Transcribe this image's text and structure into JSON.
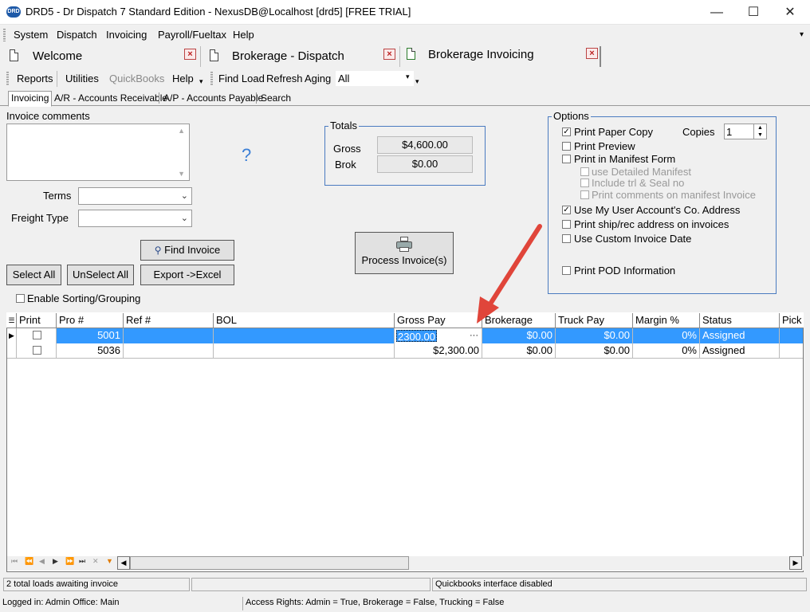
{
  "window": {
    "title": "DRD5 - Dr Dispatch 7 Standard Edition - NexusDB@Localhost [drd5] [FREE TRIAL]",
    "logo_text": "DRD",
    "minimize": "—",
    "maximize": "☐",
    "close": "✕"
  },
  "menu": [
    "System",
    "Dispatch",
    "Invoicing",
    "Payroll/Fueltax",
    "Help"
  ],
  "doc_tabs": [
    {
      "label": "Welcome"
    },
    {
      "label": "Brokerage - Dispatch"
    },
    {
      "label": "Brokerage Invoicing"
    }
  ],
  "toolbar": {
    "reports": "Reports",
    "utilities": "Utilities",
    "quickbooks": "QuickBooks",
    "help": "Help",
    "find_load": "Find Load",
    "refresh": "Refresh",
    "aging": "Aging",
    "aging_value": "All"
  },
  "subtabs": [
    "Invoicing",
    "A/R - Accounts Receivable",
    "A/P - Accounts Payable",
    "Search"
  ],
  "form": {
    "invoice_comments_label": "Invoice comments",
    "terms_label": "Terms",
    "freight_type_label": "Freight Type",
    "help_mark": "?",
    "find_invoice": "Find Invoice",
    "select_all": "Select All",
    "unselect_all": "UnSelect All",
    "export_excel": "Export ->Excel",
    "enable_sorting": "Enable Sorting/Grouping",
    "process_invoices": "Process Invoice(s)"
  },
  "totals": {
    "title": "Totals",
    "gross_label": "Gross",
    "gross_value": "$4,600.00",
    "brok_label": "Brok",
    "brok_value": "$0.00"
  },
  "options": {
    "title": "Options",
    "print_paper_copy": "Print Paper Copy",
    "print_paper_copy_checked": true,
    "copies_label": "Copies",
    "copies_value": "1",
    "print_preview": "Print Preview",
    "print_in_manifest": "Print in Manifest Form",
    "use_detailed_manifest": "use Detailed Manifest",
    "include_trl_seal": "Include trl & Seal no",
    "print_comments_manifest": "Print comments on manifest Invoice",
    "use_my_user_account": "Use My User Account's Co. Address",
    "use_my_user_account_checked": true,
    "print_ship_rec": "Print ship/rec address on invoices",
    "use_custom_date": "Use Custom Invoice Date",
    "print_pod": "Print POD Information"
  },
  "grid": {
    "columns": [
      "Print",
      "Pro #",
      "Ref #",
      "BOL",
      "Gross Pay",
      "Brokerage",
      "Truck Pay",
      "Margin %",
      "Status",
      "Pick"
    ],
    "rows": [
      {
        "pro": "5001",
        "ref": "",
        "bol": "",
        "gross": "2300.00",
        "brokerage": "$0.00",
        "truck": "$0.00",
        "margin": "0%",
        "status": "Assigned",
        "selected": true
      },
      {
        "pro": "5036",
        "ref": "",
        "bol": "",
        "gross": "$2,300.00",
        "brokerage": "$0.00",
        "truck": "$0.00",
        "margin": "0%",
        "status": "Assigned",
        "selected": false
      }
    ],
    "ellipsis": "···"
  },
  "status": {
    "loads_awaiting": "2 total loads awaiting invoice",
    "quickbooks": "Quickbooks interface disabled",
    "logged_in": "Logged in: Admin Office: Main",
    "access_rights": "Access Rights: Admin = True, Brokerage = False, Trucking = False"
  },
  "colors": {
    "selection": "#3399ff",
    "groupbox_border": "#4a7bc0",
    "arrow": "#e0453a",
    "help_mark": "#3b7fd6"
  }
}
